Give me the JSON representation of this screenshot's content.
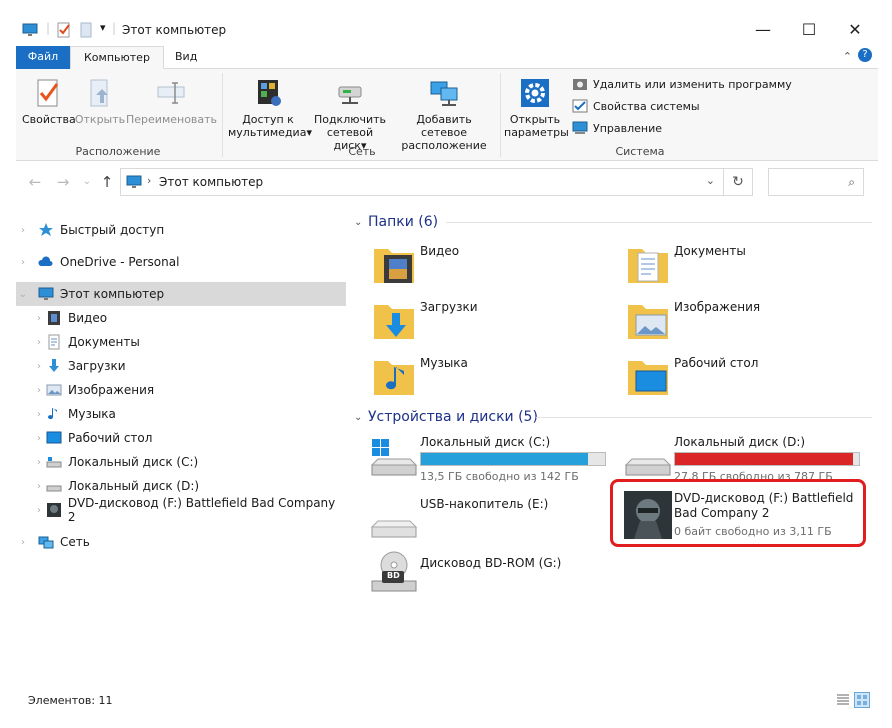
{
  "window": {
    "title": "Этот компьютер",
    "buttons": {
      "minimize": "—",
      "maximize": "☐",
      "close": "✕"
    }
  },
  "ribbon": {
    "tabs": [
      "Файл",
      "Компьютер",
      "Вид"
    ],
    "location_group": {
      "label": "Расположение",
      "properties": "Свойства",
      "open": "Открыть",
      "rename": "Переименовать"
    },
    "network_group": {
      "label": "Сеть",
      "media_access": [
        "Доступ к",
        "мультимедиа"
      ],
      "map_drive": [
        "Подключить",
        "сетевой диск"
      ],
      "add_location": [
        "Добавить сетевое",
        "расположение"
      ]
    },
    "system_group": {
      "label": "Система",
      "open_settings": [
        "Открыть",
        "параметры"
      ],
      "uninstall": "Удалить или изменить программу",
      "system_properties": "Свойства системы",
      "manage": "Управление"
    }
  },
  "address": {
    "path": "Этот компьютер"
  },
  "nav_pane": {
    "quick_access": "Быстрый доступ",
    "onedrive": "OneDrive - Personal",
    "this_pc": "Этот компьютер",
    "children": [
      "Видео",
      "Документы",
      "Загрузки",
      "Изображения",
      "Музыка",
      "Рабочий стол",
      "Локальный диск (C:)",
      "Локальный диск (D:)",
      "DVD-дисковод (F:) Battlefield Bad Company 2"
    ],
    "network": "Сеть"
  },
  "content": {
    "folders_header": "Папки (6)",
    "folders": [
      "Видео",
      "Документы",
      "Загрузки",
      "Изображения",
      "Музыка",
      "Рабочий стол"
    ],
    "devices_header": "Устройства и диски (5)",
    "drives": [
      {
        "name": "Локальный диск (C:)",
        "free": "13,5 ГБ свободно из 142 ГБ",
        "used_fraction": 0.905,
        "bar_color": "#26a0da"
      },
      {
        "name": "Локальный диск (D:)",
        "free": "27,8 ГБ свободно из 787 ГБ",
        "used_fraction": 0.965,
        "bar_color": "#da2626"
      },
      {
        "name": "USB-накопитель (E:)"
      },
      {
        "name": "DVD-дисковод (F:) Battlefield Bad Company 2",
        "free": "0 байт свободно из 3,11 ГБ"
      },
      {
        "name": "Дисковод BD-ROM (G:)",
        "badge": "BD"
      }
    ]
  },
  "status": {
    "items": "Элементов: 11"
  }
}
